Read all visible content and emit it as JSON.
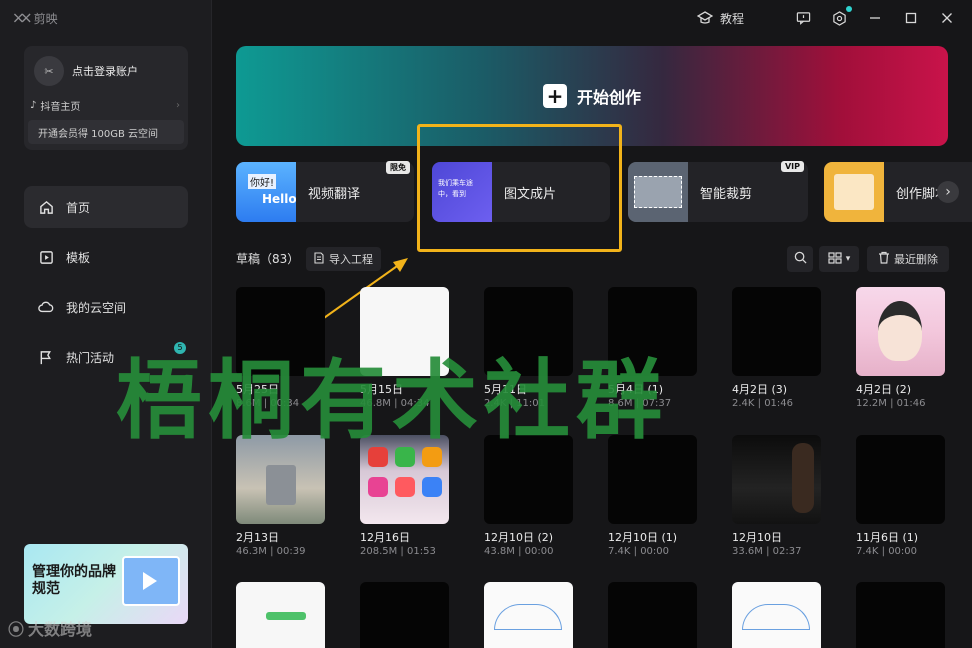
{
  "app": {
    "logo_text": "剪映"
  },
  "titlebar": {
    "tutorial_label": "教程"
  },
  "account": {
    "login_label": "点击登录账户",
    "douyin_label": "抖音主页",
    "vip_label": "开通会员得 100GB 云空间"
  },
  "nav": {
    "items": [
      {
        "label": "首页",
        "icon": "home-icon",
        "active": true
      },
      {
        "label": "模板",
        "icon": "template-icon",
        "active": false
      },
      {
        "label": "我的云空间",
        "icon": "cloud-icon",
        "active": false
      },
      {
        "label": "热门活动",
        "icon": "flag-icon",
        "active": false,
        "badge": "5"
      }
    ]
  },
  "promo": {
    "title": "管理你的品牌规范"
  },
  "create": {
    "label": "开始创作"
  },
  "features": [
    {
      "label": "视频翻译",
      "tag": "限免",
      "thumb_text_a": "你好!",
      "thumb_text_b": "Hello"
    },
    {
      "label": "图文成片",
      "thumb_text": "我们乘车途中，看到"
    },
    {
      "label": "智能裁剪",
      "tag": "VIP"
    },
    {
      "label": "创作脚本"
    }
  ],
  "drafts": {
    "label": "草稿（83）",
    "import_label": "导入工程",
    "recent_delete_label": "最近删除",
    "items": [
      {
        "date": "5月25日",
        "meta": "8.6M | 00:34",
        "style": "black"
      },
      {
        "date": "5月15日",
        "meta": "46.8M | 04:34",
        "style": "white"
      },
      {
        "date": "5月11日",
        "meta": "2.4K | 11:01",
        "style": "black"
      },
      {
        "date": "5月4日 (1)",
        "meta": "8.6M | 07:37",
        "style": "black"
      },
      {
        "date": "4月2日 (3)",
        "meta": "2.4K | 01:46",
        "style": "black"
      },
      {
        "date": "4月2日 (2)",
        "meta": "12.2M | 01:46",
        "style": "girl"
      },
      {
        "date": "2月13日",
        "meta": "46.3M | 00:39",
        "style": "photo"
      },
      {
        "date": "12月16日",
        "meta": "208.5M | 01:53",
        "style": "phone"
      },
      {
        "date": "12月10日 (2)",
        "meta": "43.8M | 00:00",
        "style": "black"
      },
      {
        "date": "12月10日 (1)",
        "meta": "7.4K | 00:00",
        "style": "black"
      },
      {
        "date": "12月10日",
        "meta": "33.6M | 02:37",
        "style": "dark-person"
      },
      {
        "date": "11月6日 (1)",
        "meta": "7.4K | 00:00",
        "style": "black"
      },
      {
        "date": "",
        "meta": "",
        "style": "white"
      },
      {
        "date": "",
        "meta": "",
        "style": "black"
      },
      {
        "date": "",
        "meta": "",
        "style": "mindmap"
      },
      {
        "date": "",
        "meta": "",
        "style": "black"
      },
      {
        "date": "",
        "meta": "",
        "style": "mindmap"
      },
      {
        "date": "",
        "meta": "",
        "style": "black"
      }
    ]
  },
  "watermark": {
    "text": "梧桐有术社群"
  },
  "corner_watermark": {
    "text": "大数跨境"
  },
  "colors": {
    "highlight": "#f2b31a",
    "watermark": "#268c3a",
    "accent": "#2fd3cf"
  }
}
